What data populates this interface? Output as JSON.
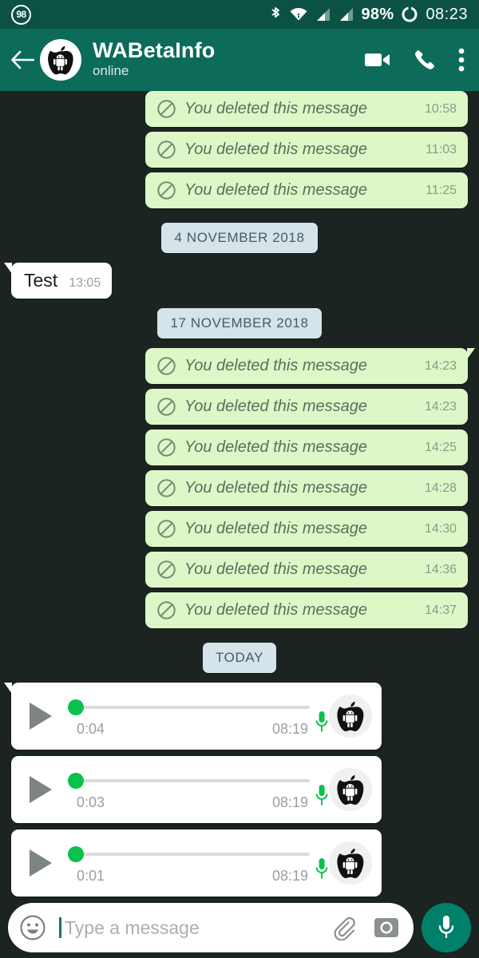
{
  "status_bar": {
    "notification_badge": "98",
    "battery_percent": "98%",
    "clock": "08:23",
    "icons": [
      "bluetooth-icon",
      "wifi-icon",
      "signal-sim1-icon",
      "signal-sim2-icon",
      "battery-circle-icon"
    ]
  },
  "header": {
    "back_label": "back-arrow-icon",
    "title": "WABetaInfo",
    "status": "online",
    "avatar_alt": "apple-android-logo",
    "actions": [
      {
        "name": "video-call-button",
        "label": "video-call-icon"
      },
      {
        "name": "voice-call-button",
        "label": "phone-icon"
      },
      {
        "name": "overflow-menu-button",
        "label": "more-vert-icon"
      }
    ]
  },
  "chat": {
    "deleted_text": "You deleted this message",
    "items": [
      {
        "kind": "deleted",
        "time": "10:58",
        "tail": false
      },
      {
        "kind": "deleted",
        "time": "11:03",
        "tail": false
      },
      {
        "kind": "deleted",
        "time": "11:25",
        "tail": false
      },
      {
        "kind": "divider",
        "label": "4 NOVEMBER 2018"
      },
      {
        "kind": "incoming",
        "text": "Test",
        "time": "13:05"
      },
      {
        "kind": "divider",
        "label": "17 NOVEMBER 2018"
      },
      {
        "kind": "deleted",
        "time": "14:23",
        "tail": true
      },
      {
        "kind": "deleted",
        "time": "14:23",
        "tail": false
      },
      {
        "kind": "deleted",
        "time": "14:25",
        "tail": false
      },
      {
        "kind": "deleted",
        "time": "14:28",
        "tail": false
      },
      {
        "kind": "deleted",
        "time": "14:30",
        "tail": false
      },
      {
        "kind": "deleted",
        "time": "14:36",
        "tail": false
      },
      {
        "kind": "deleted",
        "time": "14:37",
        "tail": false
      },
      {
        "kind": "divider",
        "label": "TODAY"
      },
      {
        "kind": "voice",
        "duration": "0:04",
        "time": "08:19",
        "tail": true
      },
      {
        "kind": "voice",
        "duration": "0:03",
        "time": "08:19",
        "tail": false
      },
      {
        "kind": "voice",
        "duration": "0:01",
        "time": "08:19",
        "tail": false
      }
    ]
  },
  "composer": {
    "placeholder": "Type a message",
    "emoji_icon": "emoji-smiley-icon",
    "attach_icon": "paperclip-icon",
    "camera_icon": "camera-icon",
    "mic_icon": "microphone-icon"
  },
  "colors": {
    "status_bar": "#0b5244",
    "header": "#0d6b5a",
    "chat_background": "#1b2421",
    "outgoing_bubble": "#ddf7c7",
    "incoming_bubble": "#ffffff",
    "divider": "#d5e3ea",
    "accent_green": "#0ac14b",
    "mic_fab": "#00806a"
  }
}
